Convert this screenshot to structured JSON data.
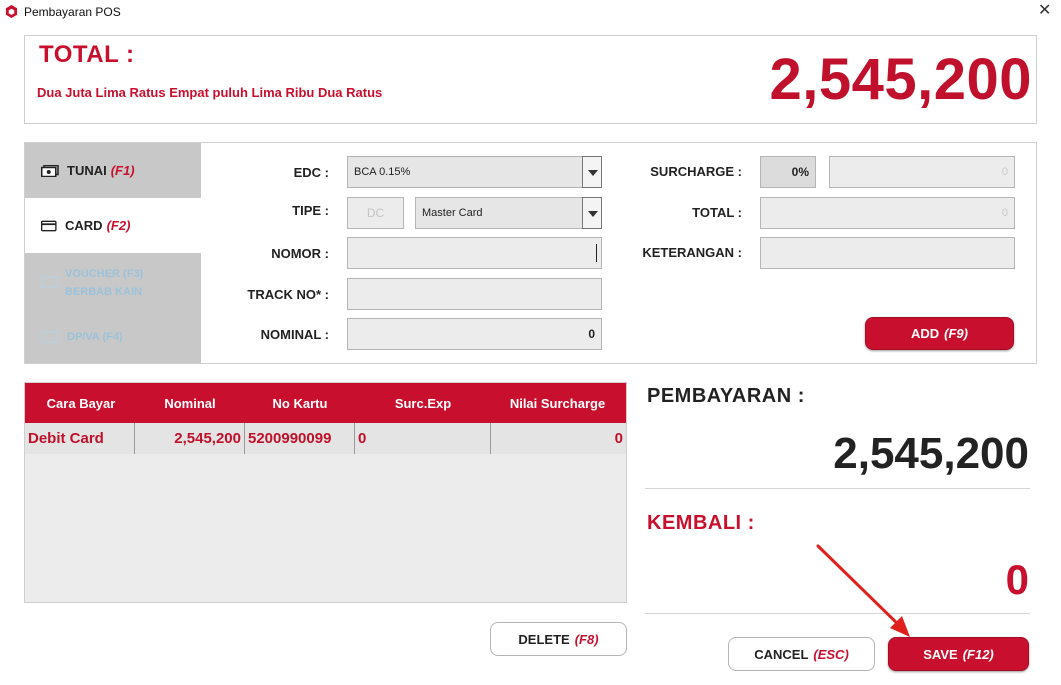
{
  "window": {
    "title": "Pembayaran POS",
    "close_glyph": "✕",
    "icon": "app-logo-icon"
  },
  "total": {
    "label": "TOTAL :",
    "words": "Dua Juta Lima Ratus Empat puluh Lima Ribu Dua Ratus",
    "amount": "2,545,200"
  },
  "tabs": [
    {
      "label": "TUNAI",
      "key": "(F1)",
      "icon": "cash-icon"
    },
    {
      "label": "CARD",
      "key": "(F2)",
      "icon": "card-icon"
    },
    {
      "label_line1": "VOUCHER (F3)",
      "label_line2": "BERBAB KAIN",
      "icon": "voucher-icon"
    },
    {
      "label": "DP/VA (F4)",
      "icon": "wallet-icon"
    }
  ],
  "card_form": {
    "edc_label": "EDC :",
    "edc_value": "BCA 0.15%",
    "tipe_label": "TIPE :",
    "tipe_code": "DC",
    "tipe_value": "Master Card",
    "nomor_label": "NOMOR :",
    "nomor_value": "",
    "track_label": "TRACK NO* :",
    "track_value": "",
    "nominal_label": "NOMINAL :",
    "nominal_value": "0",
    "surcharge_label": "SURCHARGE :",
    "surcharge_pct": "0%",
    "surcharge_value": "0",
    "total_label": "TOTAL :",
    "total_value": "0",
    "keterangan_label": "KETERANGAN :",
    "keterangan_value": "",
    "add_label": "ADD",
    "add_key": "(F9)"
  },
  "table": {
    "columns": [
      "Cara Bayar",
      "Nominal",
      "No Kartu",
      "Surc.Exp",
      "Nilai Surcharge"
    ],
    "rows": [
      [
        "Debit Card",
        "2,545,200",
        "5200990099",
        "0",
        "0"
      ]
    ]
  },
  "summary": {
    "pembayaran_label": "PEMBAYARAN :",
    "pembayaran_amount": "2,545,200",
    "kembali_label": "KEMBALI :",
    "kembali_amount": "0"
  },
  "buttons": {
    "delete_label": "DELETE",
    "delete_key": "(F8)",
    "cancel_label": "CANCEL",
    "cancel_key": "(ESC)",
    "save_label": "SAVE",
    "save_key": "(F12)"
  },
  "colors": {
    "accent": "#c8102e",
    "panel_gray": "#c8c8c8",
    "field_bg": "#ececec"
  }
}
